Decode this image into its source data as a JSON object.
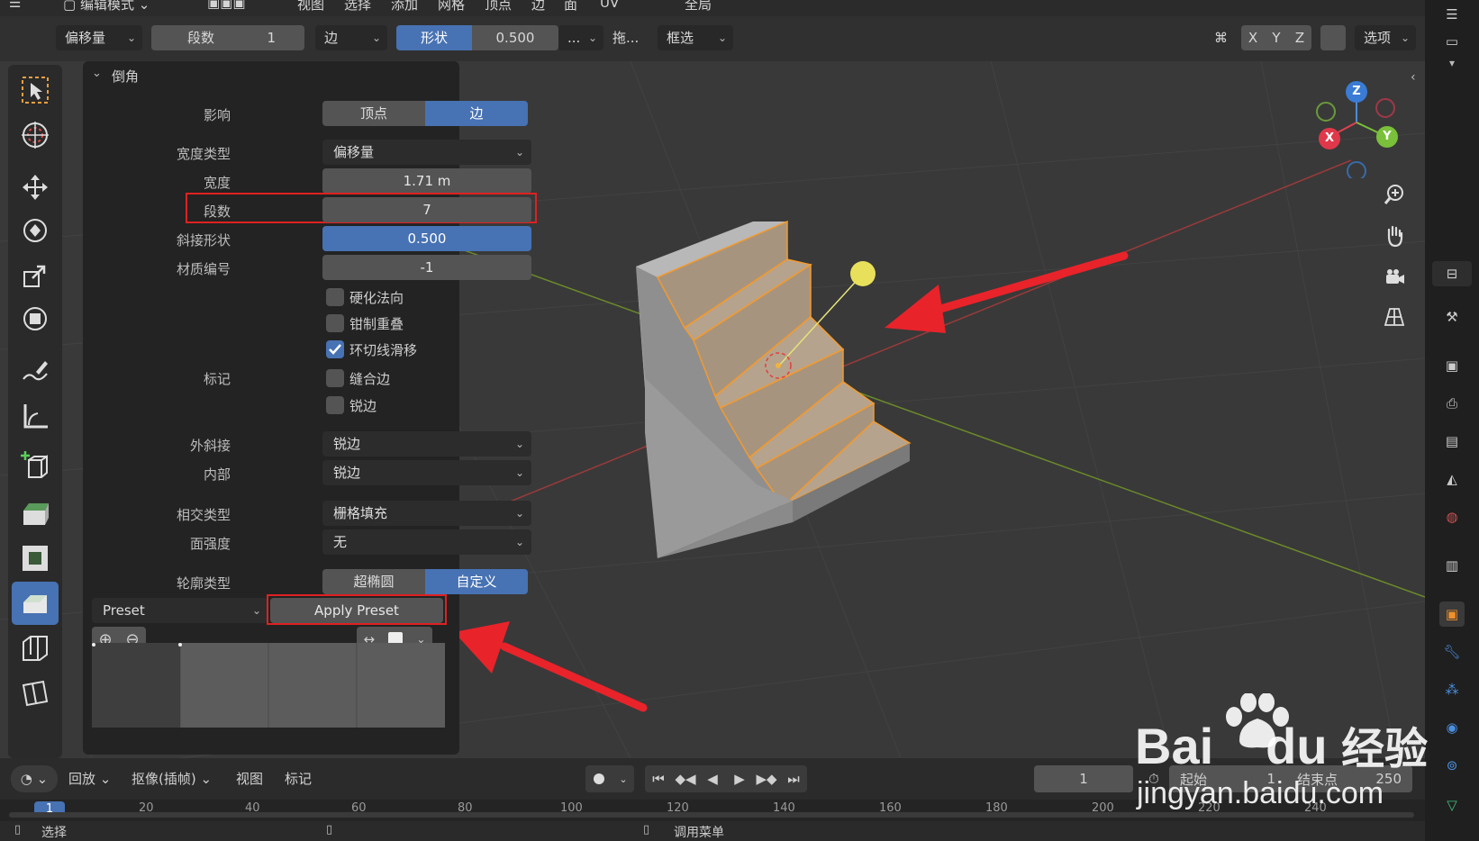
{
  "topbar": {
    "mode": "编辑模式",
    "menus": [
      "视图",
      "选择",
      "添加",
      "网格",
      "顶点",
      "边",
      "面",
      "UV"
    ],
    "orientation": "全局"
  },
  "header": {
    "offset_type": "偏移量",
    "segments_label": "段数",
    "segments_value": "1",
    "affect": "边",
    "shape_label": "形状",
    "shape_value": "0.500",
    "more": "...",
    "drag": "拖...",
    "select_box": "框选",
    "axis_x": "X",
    "axis_y": "Y",
    "axis_z": "Z",
    "options": "选项"
  },
  "panel": {
    "title": "倒角",
    "affect_label": "影响",
    "affect_vertices": "顶点",
    "affect_edges": "边",
    "width_type_label": "宽度类型",
    "width_type_value": "偏移量",
    "width_label": "宽度",
    "width_value": "1.71 m",
    "segments_label": "段数",
    "segments_value": "7",
    "shape_label": "斜接形状",
    "shape_value": "0.500",
    "material_label": "材质编号",
    "material_value": "-1",
    "harden_normals": "硬化法向",
    "clamp_overlap": "钳制重叠",
    "loop_slide": "环切线滑移",
    "mark_label": "标记",
    "mark_seam": "缝合边",
    "mark_sharp": "锐边",
    "miter_outer_label": "外斜接",
    "miter_outer_value": "锐边",
    "miter_inner_label": "内部",
    "miter_inner_value": "锐边",
    "intersection_label": "相交类型",
    "intersection_value": "栅格填充",
    "face_strength_label": "面强度",
    "face_strength_value": "无",
    "profile_type_label": "轮廓类型",
    "profile_superellipse": "超椭圆",
    "profile_custom": "自定义",
    "preset": "Preset",
    "apply_preset": "Apply Preset"
  },
  "gizmo": {
    "x": "X",
    "y": "Y",
    "z": "Z"
  },
  "timeline": {
    "playback": "回放",
    "keying": "抠像(插帧)",
    "view": "视图",
    "marker": "标记",
    "current_frame": "1",
    "start_label": "起始",
    "start_value": "1",
    "end_label": "结束点",
    "end_value": "250",
    "ticks": [
      "1",
      "20",
      "40",
      "60",
      "80",
      "100",
      "120",
      "140",
      "160",
      "180",
      "200",
      "220",
      "240"
    ]
  },
  "status": {
    "select": "选择",
    "call_menu": "调用菜单"
  },
  "watermark": {
    "brand": "Bai",
    "brand2": "du",
    "jingyan": "经验",
    "url": "jingyan.baidu.com"
  },
  "colors": {
    "accent": "#4772b3",
    "highlight_box": "#e02020",
    "arrow": "#e8232a",
    "selection": "#f39a2e"
  }
}
